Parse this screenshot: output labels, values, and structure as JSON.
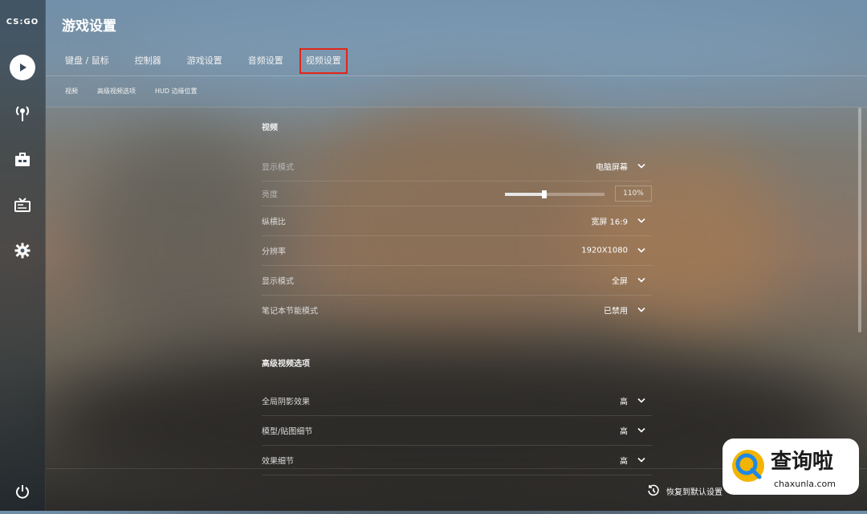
{
  "sidebar": {
    "logo": "CS:GO",
    "items": [
      {
        "icon": "play-icon"
      },
      {
        "icon": "broadcast-icon"
      },
      {
        "icon": "briefcase-icon"
      },
      {
        "icon": "tv-icon"
      },
      {
        "icon": "gear-icon"
      },
      {
        "icon": "power-icon"
      }
    ]
  },
  "header": {
    "title": "游戏设置",
    "tabs": [
      {
        "label": "键盘 / 鼠标"
      },
      {
        "label": "控制器"
      },
      {
        "label": "游戏设置"
      },
      {
        "label": "音频设置"
      },
      {
        "label": "视频设置",
        "active": true
      }
    ],
    "subtabs": [
      {
        "label": "视频"
      },
      {
        "label": "高级视频选项"
      },
      {
        "label": "HUD 边缘位置"
      }
    ]
  },
  "video": {
    "title": "视频",
    "rows": [
      {
        "label": "显示模式",
        "value": "电脑屏幕"
      },
      {
        "label": "亮度",
        "percent": "110%",
        "slider_fraction": 0.42
      },
      {
        "label": "纵横比",
        "value": "宽屏 16:9"
      },
      {
        "label": "分辨率",
        "value": "1920X1080"
      },
      {
        "label": "显示模式",
        "value": "全屏"
      },
      {
        "label": "笔记本节能模式",
        "value": "已禁用"
      }
    ]
  },
  "advanced": {
    "title": "高级视频选项",
    "rows": [
      {
        "label": "全局阴影效果",
        "value": "高"
      },
      {
        "label": "模型/贴图细节",
        "value": "高"
      },
      {
        "label": "效果细节",
        "value": "高"
      }
    ]
  },
  "footer": {
    "restore_label": "恢复到默认设置"
  },
  "watermark": {
    "text": "查询啦",
    "url": "chaxunla.com"
  },
  "colors": {
    "active_tab_border": "#e0251b"
  }
}
